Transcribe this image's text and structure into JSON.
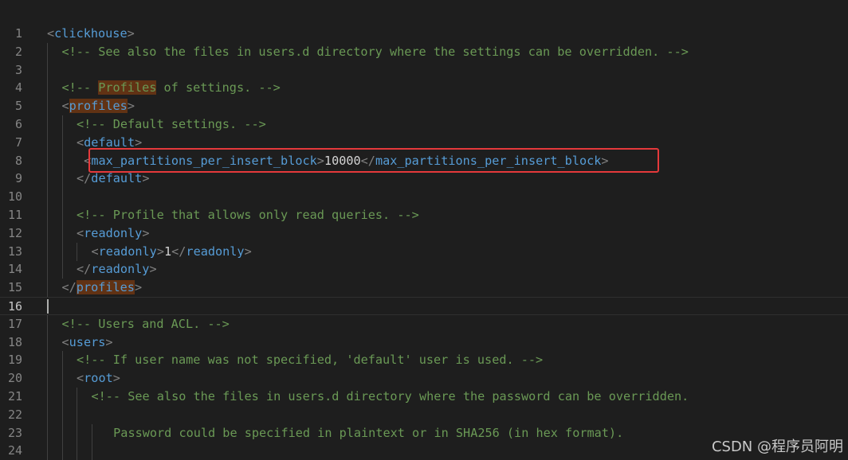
{
  "editor": {
    "lines": [
      {
        "n": "1",
        "depth": 0,
        "tokens": [
          {
            "t": "<",
            "c": "p"
          },
          {
            "t": "clickhouse",
            "c": "tag"
          },
          {
            "t": ">",
            "c": "p"
          }
        ]
      },
      {
        "n": "2",
        "depth": 1,
        "tokens": [
          {
            "t": "<!-- See also the files in users.d directory where the settings can be overridden. -->",
            "c": "cm"
          }
        ]
      },
      {
        "n": "3",
        "depth": 1,
        "tokens": []
      },
      {
        "n": "4",
        "depth": 1,
        "tokens": [
          {
            "t": "<!-- ",
            "c": "cm"
          },
          {
            "t": "Profiles",
            "c": "cm",
            "hl": true
          },
          {
            "t": " of settings. -->",
            "c": "cm"
          }
        ]
      },
      {
        "n": "5",
        "depth": 1,
        "tokens": [
          {
            "t": "<",
            "c": "p"
          },
          {
            "t": "profiles",
            "c": "tag",
            "hl": true
          },
          {
            "t": ">",
            "c": "p"
          }
        ]
      },
      {
        "n": "6",
        "depth": 2,
        "tokens": [
          {
            "t": "<!-- Default settings. -->",
            "c": "cm"
          }
        ]
      },
      {
        "n": "7",
        "depth": 2,
        "tokens": [
          {
            "t": "<",
            "c": "p"
          },
          {
            "t": "default",
            "c": "tag"
          },
          {
            "t": ">",
            "c": "p"
          }
        ]
      },
      {
        "n": "8",
        "depth": 2,
        "extra": " ",
        "tokens": [
          {
            "t": "<",
            "c": "p"
          },
          {
            "t": "max_partitions_per_insert_block",
            "c": "tag"
          },
          {
            "t": ">",
            "c": "p"
          },
          {
            "t": "10000",
            "c": "text"
          },
          {
            "t": "</",
            "c": "p"
          },
          {
            "t": "max_partitions_per_insert_block",
            "c": "tag"
          },
          {
            "t": ">",
            "c": "p"
          }
        ]
      },
      {
        "n": "9",
        "depth": 2,
        "tokens": [
          {
            "t": "</",
            "c": "p"
          },
          {
            "t": "default",
            "c": "tag"
          },
          {
            "t": ">",
            "c": "p"
          }
        ]
      },
      {
        "n": "10",
        "depth": 2,
        "tokens": []
      },
      {
        "n": "11",
        "depth": 2,
        "tokens": [
          {
            "t": "<!-- Profile that allows only read queries. -->",
            "c": "cm"
          }
        ]
      },
      {
        "n": "12",
        "depth": 2,
        "tokens": [
          {
            "t": "<",
            "c": "p"
          },
          {
            "t": "readonly",
            "c": "tag"
          },
          {
            "t": ">",
            "c": "p"
          }
        ]
      },
      {
        "n": "13",
        "depth": 3,
        "tokens": [
          {
            "t": "<",
            "c": "p"
          },
          {
            "t": "readonly",
            "c": "tag"
          },
          {
            "t": ">",
            "c": "p"
          },
          {
            "t": "1",
            "c": "text"
          },
          {
            "t": "</",
            "c": "p"
          },
          {
            "t": "readonly",
            "c": "tag"
          },
          {
            "t": ">",
            "c": "p"
          }
        ]
      },
      {
        "n": "14",
        "depth": 2,
        "tokens": [
          {
            "t": "</",
            "c": "p"
          },
          {
            "t": "readonly",
            "c": "tag"
          },
          {
            "t": ">",
            "c": "p"
          }
        ]
      },
      {
        "n": "15",
        "depth": 1,
        "tokens": [
          {
            "t": "</",
            "c": "p"
          },
          {
            "t": "profiles",
            "c": "tag",
            "hl": true
          },
          {
            "t": ">",
            "c": "p"
          }
        ]
      },
      {
        "n": "16",
        "depth": 0,
        "current": true,
        "tokens": []
      },
      {
        "n": "17",
        "depth": 1,
        "tokens": [
          {
            "t": "<!-- Users and ACL. -->",
            "c": "cm"
          }
        ]
      },
      {
        "n": "18",
        "depth": 1,
        "tokens": [
          {
            "t": "<",
            "c": "p"
          },
          {
            "t": "users",
            "c": "tag"
          },
          {
            "t": ">",
            "c": "p"
          }
        ]
      },
      {
        "n": "19",
        "depth": 2,
        "tokens": [
          {
            "t": "<!-- If user name was not specified, 'default' user is used. -->",
            "c": "cm"
          }
        ]
      },
      {
        "n": "20",
        "depth": 2,
        "tokens": [
          {
            "t": "<",
            "c": "p"
          },
          {
            "t": "root",
            "c": "tag"
          },
          {
            "t": ">",
            "c": "p"
          }
        ]
      },
      {
        "n": "21",
        "depth": 3,
        "tokens": [
          {
            "t": "<!-- See also the files in users.d directory where the password can be overridden.",
            "c": "cm"
          }
        ]
      },
      {
        "n": "22",
        "depth": 3,
        "tokens": []
      },
      {
        "n": "23",
        "depth": 4,
        "extra": " ",
        "tokens": [
          {
            "t": "Password could be specified in plaintext or in SHA256 (in hex format).",
            "c": "cm"
          }
        ]
      },
      {
        "n": "24",
        "depth": 4,
        "tokens": []
      }
    ]
  },
  "highlight_box": {
    "color": "#e5393b",
    "line": "8"
  },
  "watermark": "CSDN @程序员阿明"
}
